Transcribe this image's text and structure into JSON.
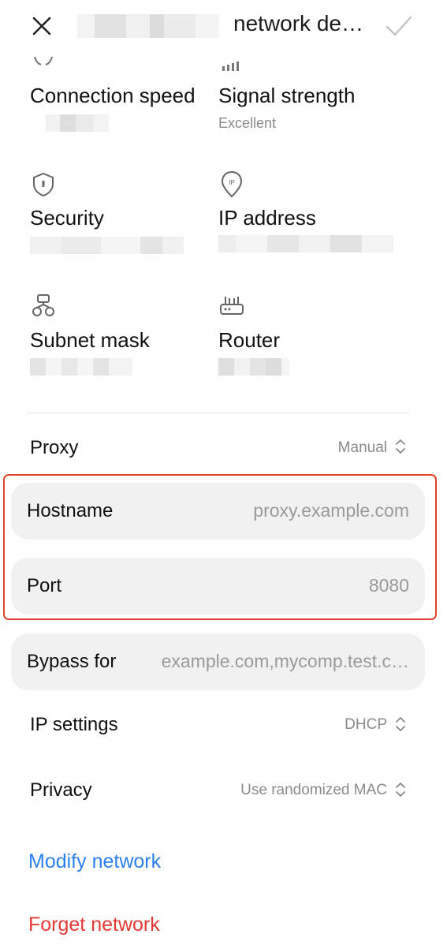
{
  "header": {
    "title": "network de…",
    "close_icon": "close-icon",
    "confirm_icon": "check-icon"
  },
  "details": [
    {
      "icon": "speed-icon",
      "label": "Connection speed",
      "value": ""
    },
    {
      "icon": "signal-icon",
      "label": "Signal strength",
      "value": "Excellent"
    },
    {
      "icon": "shield-icon",
      "label": "Security",
      "value": ""
    },
    {
      "icon": "ip-location-icon",
      "label": "IP address",
      "value": ""
    },
    {
      "icon": "network-topology-icon",
      "label": "Subnet mask",
      "value": ""
    },
    {
      "icon": "router-icon",
      "label": "Router",
      "value": ""
    }
  ],
  "proxy": {
    "label": "Proxy",
    "value": "Manual"
  },
  "hostname": {
    "label": "Hostname",
    "placeholder": "proxy.example.com"
  },
  "port": {
    "label": "Port",
    "placeholder": "8080"
  },
  "bypass": {
    "label": "Bypass for",
    "placeholder": "example.com,mycomp.test.c…"
  },
  "ip_settings": {
    "label": "IP settings",
    "value": "DHCP"
  },
  "privacy": {
    "label": "Privacy",
    "value": "Use randomized MAC"
  },
  "actions": {
    "modify": "Modify network",
    "forget": "Forget network"
  },
  "colors": {
    "highlight": "#e0452f",
    "modify_link": "#2d7ff0",
    "forget_link": "#e53935",
    "pill_bg": "#f1f1f1"
  }
}
